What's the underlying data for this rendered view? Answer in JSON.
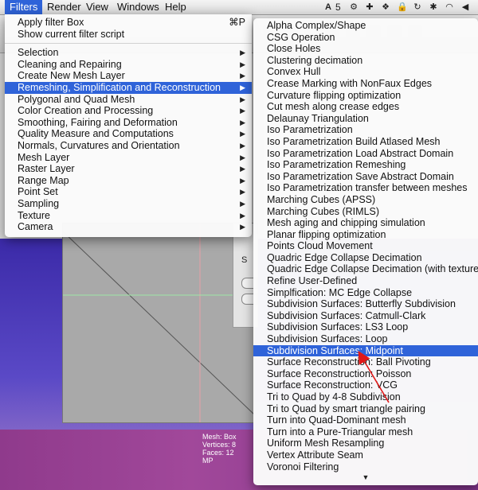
{
  "menubar": {
    "items": [
      "Filters",
      "Render",
      "View",
      "Windows",
      "Help"
    ],
    "active": "Filters",
    "status_number": "5"
  },
  "filters_menu": {
    "top": [
      {
        "label": "Apply filter Box",
        "shortcut": "⌘P"
      },
      {
        "label": "Show current filter script"
      }
    ],
    "categories": [
      "Selection",
      "Cleaning and Repairing",
      "Create New Mesh Layer",
      "Remeshing, Simplification and Reconstruction",
      "Polygonal and Quad Mesh",
      "Color Creation and Processing",
      "Smoothing, Fairing and Deformation",
      "Quality Measure and Computations",
      "Normals, Curvatures and Orientation",
      "Mesh Layer",
      "Raster Layer",
      "Range Map",
      "Point Set",
      "Sampling",
      "Texture",
      "Camera"
    ],
    "selected_category": "Remeshing, Simplification and Reconstruction"
  },
  "submenu": {
    "items": [
      "Alpha Complex/Shape",
      "CSG Operation",
      "Close Holes",
      "Clustering decimation",
      "Convex Hull",
      "Crease Marking with NonFaux Edges",
      "Curvature flipping optimization",
      "Cut mesh along crease edges",
      "Delaunay Triangulation",
      "Iso Parametrization",
      "Iso Parametrization Build Atlased Mesh",
      "Iso Parametrization Load Abstract Domain",
      "Iso Parametrization Remeshing",
      "Iso Parametrization Save Abstract Domain",
      "Iso Parametrization transfer between meshes",
      "Marching Cubes (APSS)",
      "Marching Cubes (RIMLS)",
      "Mesh aging and chipping simulation",
      "Planar flipping optimization",
      "Points Cloud Movement",
      "Quadric Edge Collapse Decimation",
      "Quadric Edge Collapse Decimation (with texture)",
      "Refine User-Defined",
      "Simplfication: MC Edge Collapse",
      "Subdivision Surfaces: Butterfly Subdivision",
      "Subdivision Surfaces: Catmull-Clark",
      "Subdivision Surfaces: LS3 Loop",
      "Subdivision Surfaces: Loop",
      "Subdivision Surfaces: Midpoint",
      "Surface Reconstruction: Ball Pivoting",
      "Surface Reconstruction: Poisson",
      "Surface Reconstruction: VCG",
      "Tri to Quad by 4-8 Subdivision",
      "Tri to Quad by smart triangle pairing",
      "Turn into Quad-Dominant mesh",
      "Turn into a Pure-Triangular mesh",
      "Uniform Mesh Resampling",
      "Vertex Attribute Seam",
      "Voronoi Filtering"
    ],
    "selected": "Subdivision Surfaces: Midpoint"
  },
  "mesh_info": {
    "line1": "Mesh: Box",
    "line2": "Vertices: 8",
    "line3": "Faces: 12",
    "line4": "MP"
  },
  "background_dialog": {
    "label": "S"
  },
  "colors": {
    "selection": "#2f63d9",
    "annotation_arrow": "#e01818",
    "viewport_bg": "#4a39b8"
  }
}
